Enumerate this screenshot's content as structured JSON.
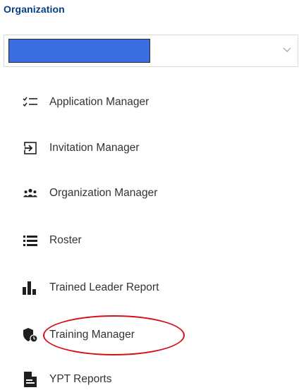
{
  "section": {
    "heading": "Organization"
  },
  "org_select": {
    "selected_value": "",
    "chevron_icon": "chevron-down-icon"
  },
  "menu": {
    "items": [
      {
        "label": "Application Manager",
        "icon": "checklist-icon"
      },
      {
        "label": "Invitation Manager",
        "icon": "login-arrow-icon"
      },
      {
        "label": "Organization Manager",
        "icon": "group-icon"
      },
      {
        "label": "Roster",
        "icon": "list-icon"
      },
      {
        "label": "Trained Leader Report",
        "icon": "bar-chart-icon"
      },
      {
        "label": "Training Manager",
        "icon": "shield-clock-icon"
      },
      {
        "label": "YPT Reports",
        "icon": "document-icon"
      }
    ]
  },
  "colors": {
    "heading": "#003f87",
    "icon": "#1f1f1f",
    "text": "#333333",
    "annotation": "#d4111b",
    "redaction": "#3a6ee0"
  }
}
